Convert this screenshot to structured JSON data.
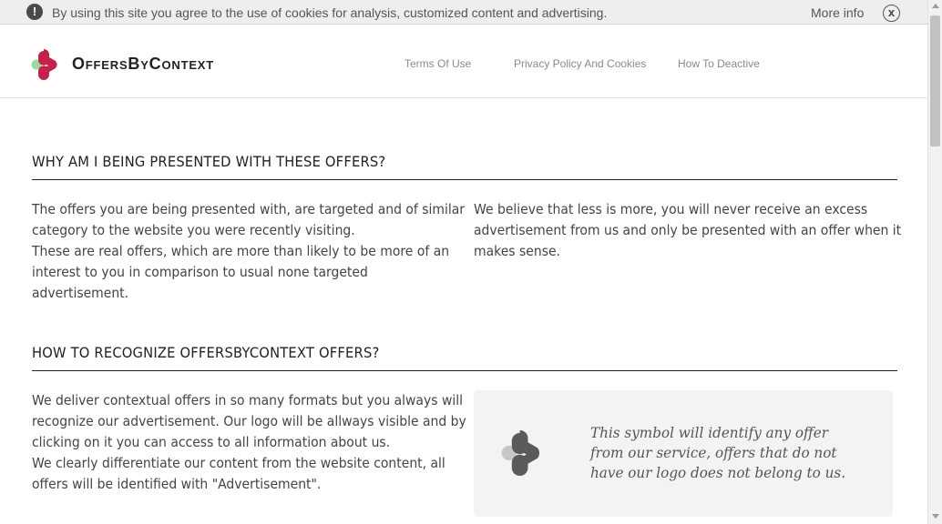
{
  "cookie_bar": {
    "alert_icon": "!",
    "message": "By using this site you agree to the use of cookies for analysis, customized content and advertising.",
    "more_info": "More info",
    "close_icon": "x"
  },
  "header": {
    "logo_text": "OffersByContext",
    "nav": [
      "Terms Of Use",
      "Privacy Policy And Cookies",
      "How To Deactive"
    ]
  },
  "colors": {
    "brand": "#c4214b",
    "dot": "#9fd6a3",
    "dark_mark": "#5a5a5a",
    "light_dot": "#c7c7c7"
  },
  "sections": [
    {
      "title": "WHY AM I BEING PRESENTED WITH THESE OFFERS?",
      "left_lines": [
        "The offers you are being presented with, are targeted and of similar",
        "category to the website you were recently visiting.",
        "These are real offers, which are more than likely to be more of an",
        "interest to you in comparison to usual none targeted",
        "advertisement."
      ],
      "right_lines": [
        "We believe that less is more, you will never receive an excess",
        "advertisement from us and only be presented with an offer when it",
        "makes sense."
      ]
    },
    {
      "title": "HOW TO RECOGNIZE OFFERSBYCONTEXT OFFERS?",
      "left_lines": [
        "We deliver contextual offers in so many formats but you always will",
        "recognize our advertisement. Our logo will be allways visible and by",
        "clicking on it you can access to all information about us.",
        "We clearly differentiate our content from the website content, all",
        "offers will be identified with \"Advertisement\"."
      ],
      "box_lines": [
        "This symbol will identify any offer",
        "from our service, offers that do not",
        "have our logo does not belong to us."
      ]
    }
  ]
}
